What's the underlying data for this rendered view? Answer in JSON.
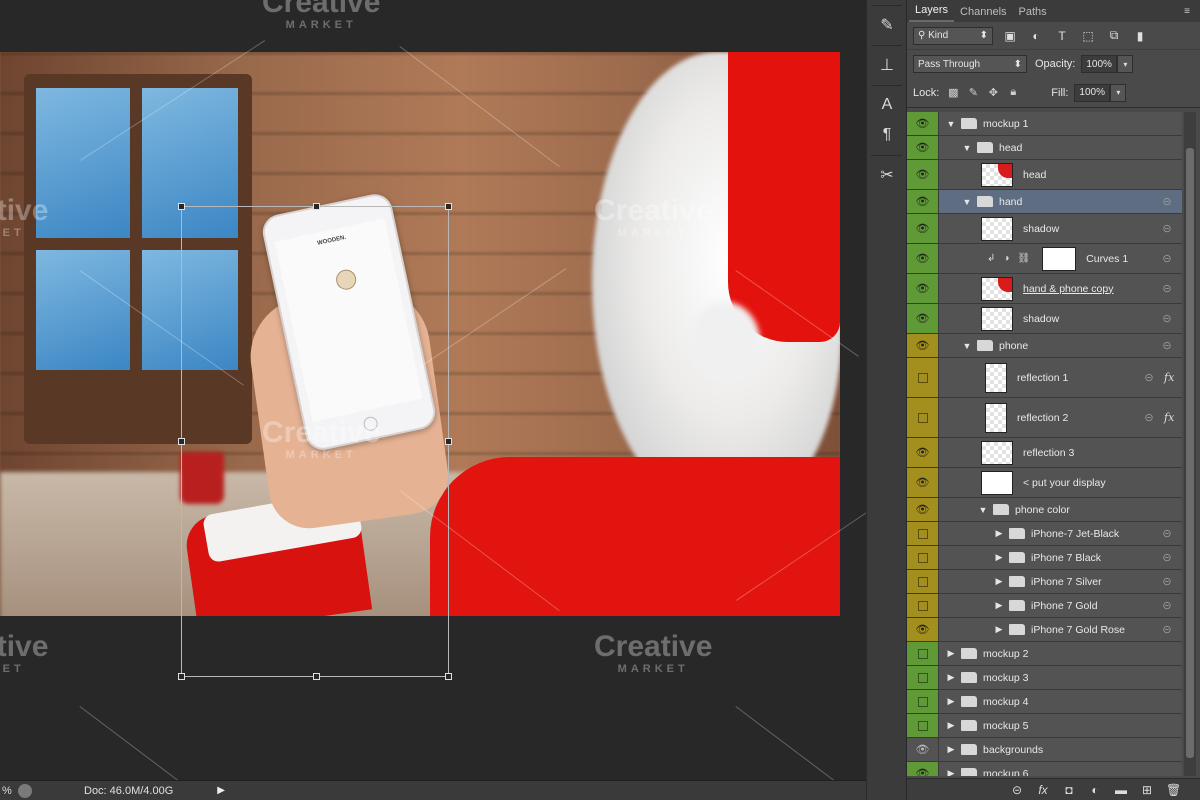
{
  "status_bar": {
    "zoom": "%",
    "doc": "Doc: 46.0M/4.00G",
    "arrow": "▶"
  },
  "panel": {
    "tabs": [
      "Layers",
      "Channels",
      "Paths"
    ],
    "filter": {
      "kind": "Kind"
    },
    "blend_mode": "Pass Through",
    "opacity_label": "Opacity:",
    "opacity_value": "100%",
    "lock_label": "Lock:",
    "fill_label": "Fill:",
    "fill_value": "100%"
  },
  "layers": [
    {
      "name": "mockup 1",
      "type": "folder",
      "level": 0,
      "expanded": true,
      "vis": "green",
      "eye": true
    },
    {
      "name": "head",
      "type": "folder",
      "level": 1,
      "expanded": true,
      "vis": "green",
      "eye": true
    },
    {
      "name": "head",
      "type": "layer",
      "level": 2,
      "vis": "green",
      "eye": true,
      "thumb": "red"
    },
    {
      "name": "hand",
      "type": "folder",
      "level": 1,
      "expanded": true,
      "vis": "green",
      "eye": true,
      "selected": true,
      "link": true
    },
    {
      "name": "shadow",
      "type": "layer",
      "level": 2,
      "vis": "green",
      "eye": true,
      "link": true
    },
    {
      "name": "Curves 1",
      "type": "adjustment",
      "level": 2,
      "vis": "green",
      "eye": true,
      "link": true
    },
    {
      "name": "hand & phone copy",
      "type": "layer",
      "level": 2,
      "vis": "green",
      "eye": true,
      "thumb": "red",
      "underline": true,
      "link": true
    },
    {
      "name": "shadow",
      "type": "layer",
      "level": 2,
      "vis": "green",
      "eye": true,
      "link": true
    },
    {
      "name": "phone",
      "type": "folder",
      "level": 1,
      "expanded": true,
      "vis": "olive",
      "eye": true,
      "link": true
    },
    {
      "name": "reflection 1",
      "type": "layer",
      "level": 2,
      "vis": "olive",
      "eye": false,
      "tall": true,
      "fx": true,
      "link": true
    },
    {
      "name": "reflection 2",
      "type": "layer",
      "level": 2,
      "vis": "olive",
      "eye": false,
      "tall": true,
      "fx": true,
      "link": true
    },
    {
      "name": "reflection 3",
      "type": "layer",
      "level": 2,
      "vis": "olive",
      "eye": true
    },
    {
      "name": "< put your display",
      "type": "layer",
      "level": 2,
      "vis": "olive",
      "eye": true,
      "thumb": "white"
    },
    {
      "name": "phone color",
      "type": "folder",
      "level": 2,
      "expanded": true,
      "vis": "olive",
      "eye": true
    },
    {
      "name": "iPhone-7 Jet-Black",
      "type": "folder",
      "level": 3,
      "expanded": false,
      "vis": "olive",
      "eye": false,
      "link": true
    },
    {
      "name": "iPhone 7 Black",
      "type": "folder",
      "level": 3,
      "expanded": false,
      "vis": "olive",
      "eye": false,
      "link": true
    },
    {
      "name": "iPhone 7 Silver",
      "type": "folder",
      "level": 3,
      "expanded": false,
      "vis": "olive",
      "eye": false,
      "link": true
    },
    {
      "name": "iPhone 7 Gold",
      "type": "folder",
      "level": 3,
      "expanded": false,
      "vis": "olive",
      "eye": false,
      "link": true
    },
    {
      "name": "iPhone 7 Gold Rose",
      "type": "folder",
      "level": 3,
      "expanded": false,
      "vis": "olive",
      "eye": true,
      "link": true
    },
    {
      "name": "mockup 2",
      "type": "folder",
      "level": 0,
      "expanded": false,
      "vis": "green",
      "eye": false
    },
    {
      "name": "mockup 3",
      "type": "folder",
      "level": 0,
      "expanded": false,
      "vis": "green",
      "eye": false
    },
    {
      "name": "mockup 4",
      "type": "folder",
      "level": 0,
      "expanded": false,
      "vis": "green",
      "eye": false
    },
    {
      "name": "mockup 5",
      "type": "folder",
      "level": 0,
      "expanded": false,
      "vis": "green",
      "eye": false
    },
    {
      "name": "backgrounds",
      "type": "folder",
      "level": 0,
      "expanded": false,
      "vis": "gray",
      "eye": true
    },
    {
      "name": "mockup 6",
      "type": "folder",
      "level": 0,
      "expanded": false,
      "vis": "green",
      "eye": true
    }
  ],
  "canvas": {
    "phone_screen_title": "WOODEN."
  },
  "watermark": {
    "brand": "Creative",
    "sub": "MARKET"
  },
  "colors": {
    "vis_green": "#5f9a36",
    "vis_olive": "#a38f1d",
    "selected": "#5f6d82"
  }
}
